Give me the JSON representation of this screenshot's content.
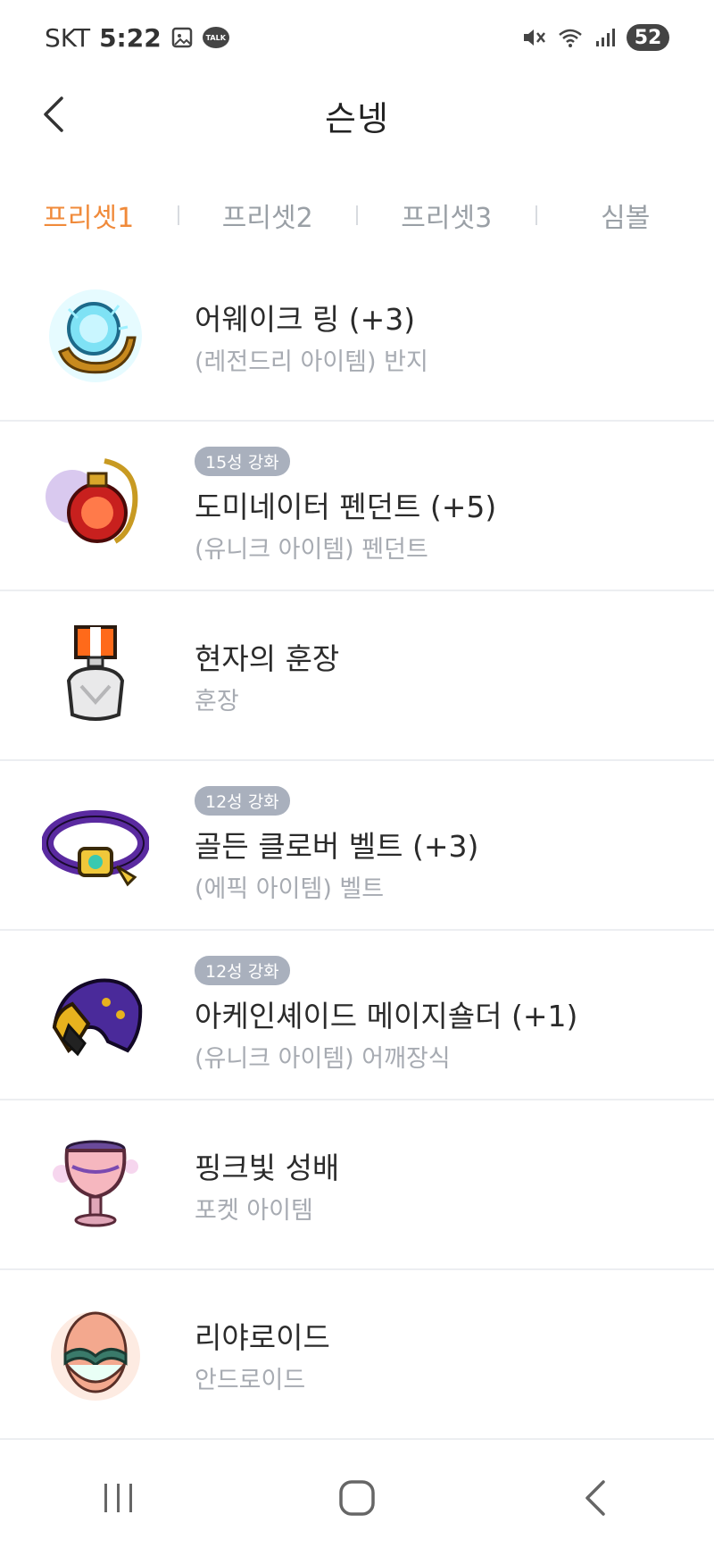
{
  "status_bar": {
    "carrier": "SKT",
    "time": "5:22",
    "talk_label": "TALK",
    "battery": "52"
  },
  "header": {
    "title": "슨넹"
  },
  "tabs": [
    {
      "label": "프리셋1",
      "active": true
    },
    {
      "label": "프리셋2",
      "active": false
    },
    {
      "label": "프리셋3",
      "active": false
    },
    {
      "label": "심볼",
      "active": false
    }
  ],
  "items": [
    {
      "icon": "ring-icon",
      "badge": "",
      "name": "어웨이크 링 (+3)",
      "sub": "(레전드리 아이템) 반지"
    },
    {
      "icon": "pendant-icon",
      "badge": "15성 강화",
      "name": "도미네이터 펜던트 (+5)",
      "sub": "(유니크 아이템) 펜던트"
    },
    {
      "icon": "medal-icon",
      "badge": "",
      "name": "현자의 훈장",
      "sub": "훈장"
    },
    {
      "icon": "belt-icon",
      "badge": "12성 강화",
      "name": "골든 클로버 벨트 (+3)",
      "sub": "(에픽 아이템) 벨트"
    },
    {
      "icon": "shoulder-icon",
      "badge": "12성 강화",
      "name": "아케인셰이드 메이지숄더 (+1)",
      "sub": "(유니크 아이템) 어깨장식"
    },
    {
      "icon": "chalice-icon",
      "badge": "",
      "name": "핑크빛 성배",
      "sub": "포켓 아이템"
    },
    {
      "icon": "android-egg-icon",
      "badge": "",
      "name": "리야로이드",
      "sub": "안드로이드"
    }
  ],
  "colors": {
    "accent": "#f08a3a",
    "badge_bg": "#a9b0bd",
    "muted_text": "#a7abb2"
  }
}
